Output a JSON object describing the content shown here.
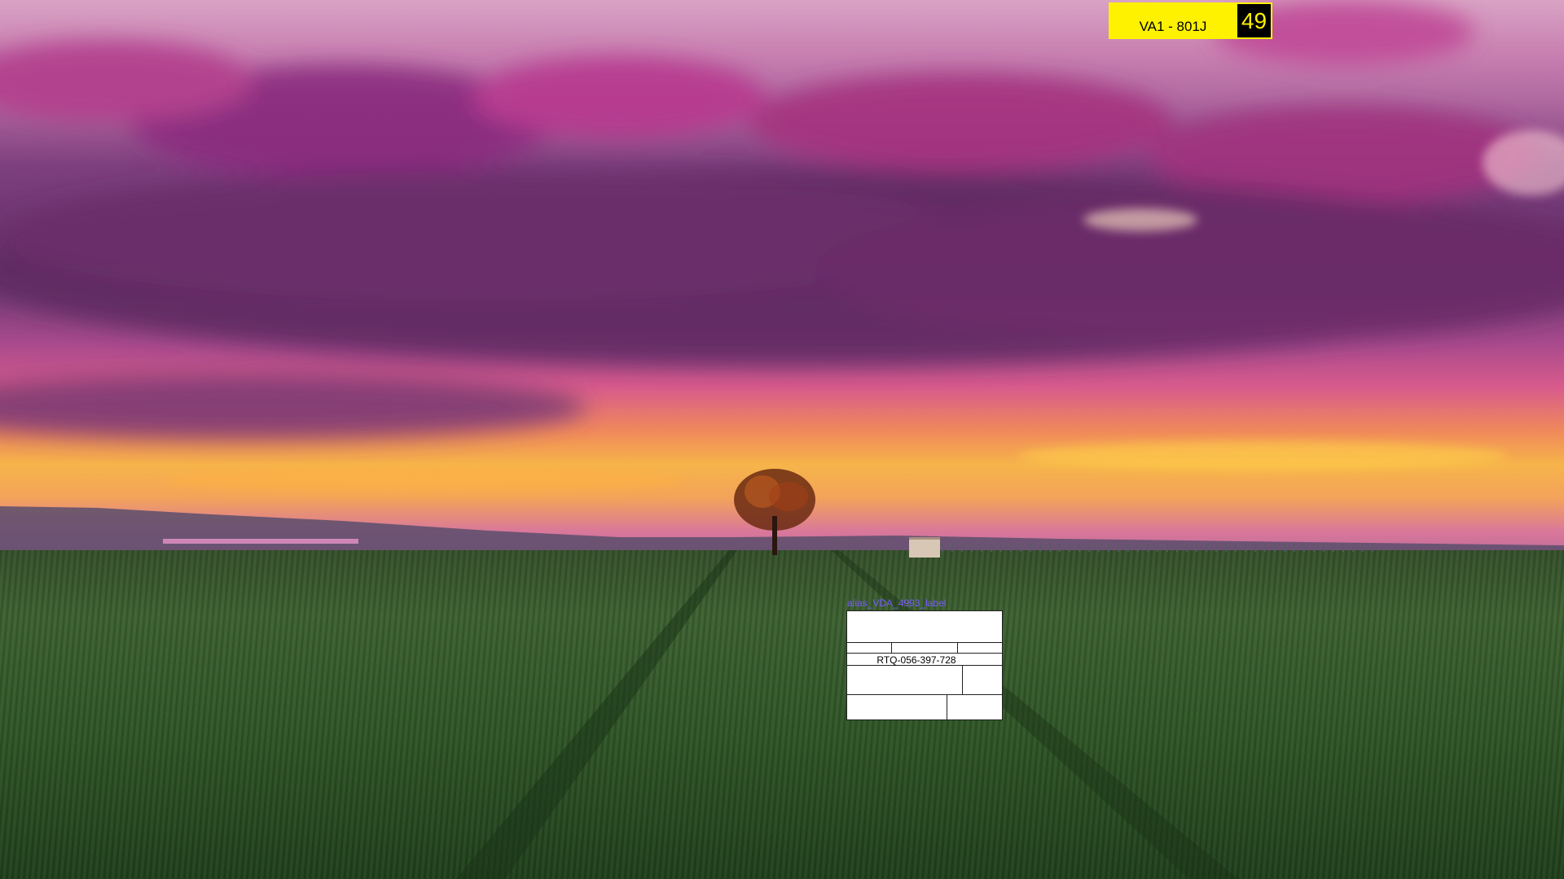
{
  "badge": {
    "label": "VA1 - 801J",
    "count": "49",
    "bg_color": "#fff200",
    "count_bg_color": "#000000"
  },
  "widget": {
    "title": "alias_VDA_4993_label",
    "serial": "RTQ-056-397-728",
    "title_color": "#7a5bff"
  }
}
